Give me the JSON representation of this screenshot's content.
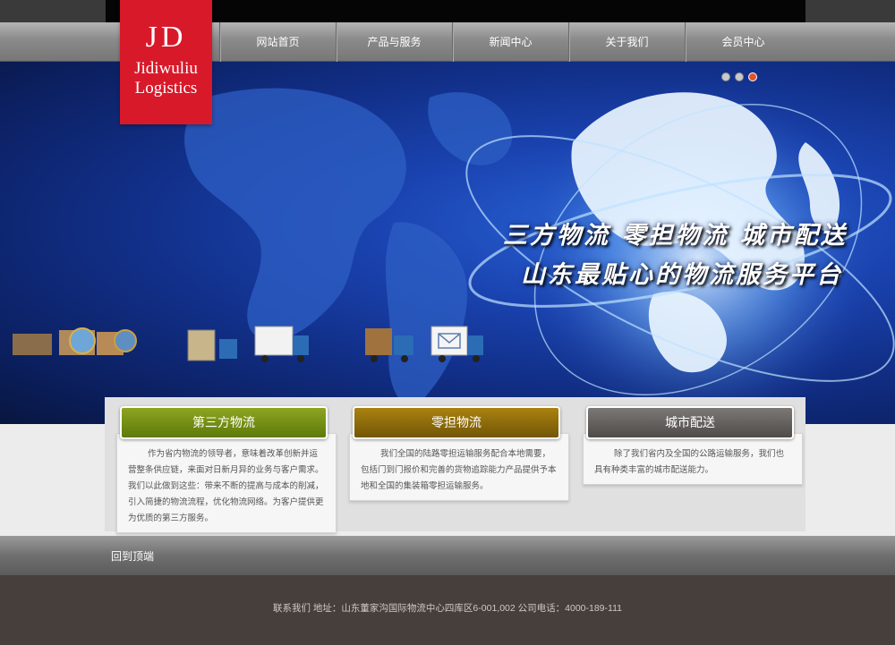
{
  "logo": {
    "initials": "JD",
    "line1": "Jidiwuliu",
    "line2": "Logistics"
  },
  "nav": {
    "items": [
      {
        "label": "网站首页"
      },
      {
        "label": "产品与服务"
      },
      {
        "label": "新闻中心"
      },
      {
        "label": "关于我们"
      },
      {
        "label": "会员中心"
      }
    ]
  },
  "banner": {
    "slogan_line1": "三方物流 零担物流 城市配送",
    "slogan_line2": "山东最贴心的物流服务平台",
    "slide_count": 3,
    "active_slide": 3
  },
  "services": [
    {
      "title": "第三方物流",
      "text": "作为省内物流的领导者，意味着改革创新并运营整条供应链，来面对日新月异的业务与客户需求。我们以此做到这些：带来不断的提高与成本的削减，引入简捷的物流流程，优化物流网络。为客户提供更为优质的第三方服务。"
    },
    {
      "title": "零担物流",
      "text": "我们全国的陆路零担运输服务配合本地需要，包括门到门报价和完善的货物追踪能力产品提供予本地和全国的集装箱零担运输服务。"
    },
    {
      "title": "城市配送",
      "text": "除了我们省内及全国的公路运输服务，我们也具有种类丰富的城市配送能力。"
    }
  ],
  "back_to_top": "回到顶端",
  "footer": {
    "contact": "联系我们 地址：山东董家沟国际物流中心四库区6-001,002 公司电话：4000-189-111"
  },
  "colors": {
    "logo_red": "#d8192a",
    "green": "#6f8c12",
    "gold": "#8a6a0a",
    "gray": "#605c5a",
    "footer_bg": "#463f3b"
  }
}
